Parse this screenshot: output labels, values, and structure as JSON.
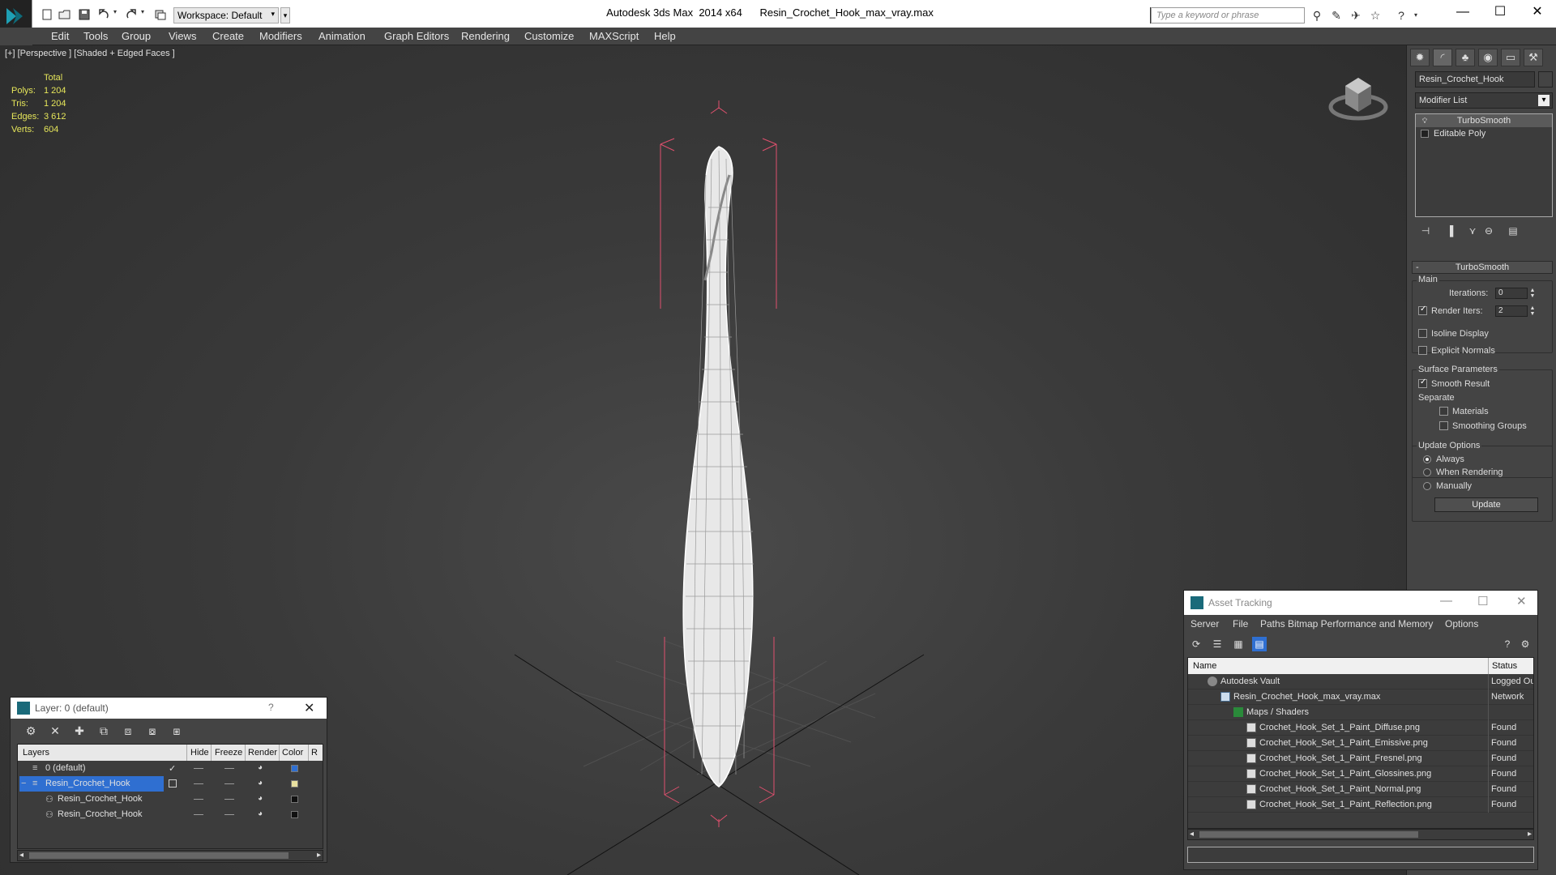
{
  "titlebar": {
    "workspace": "Workspace: Default",
    "title": "Autodesk 3ds Max  2014 x64      Resin_Crochet_Hook_max_vray.max",
    "search_placeholder": "Type a keyword or phrase"
  },
  "menu": [
    "Edit",
    "Tools",
    "Group",
    "Views",
    "Create",
    "Modifiers",
    "Animation",
    "Graph Editors",
    "Rendering",
    "Customize",
    "MAXScript",
    "Help"
  ],
  "viewport": {
    "label": "[+] [Perspective ] [Shaded + Edged Faces ]",
    "stats_header": "Total",
    "stats": [
      {
        "k": "Polys:",
        "v": "1 204"
      },
      {
        "k": "Tris:",
        "v": "1 204"
      },
      {
        "k": "Edges:",
        "v": "3 612"
      },
      {
        "k": "Verts:",
        "v": "604"
      }
    ]
  },
  "command_panel": {
    "object_name": "Resin_Crochet_Hook",
    "modifier_list": "Modifier List",
    "stack": [
      "TurboSmooth",
      "Editable Poly"
    ],
    "rollout_title": "TurboSmooth",
    "main_group": "Main",
    "iterations_label": "Iterations:",
    "iterations_value": "0",
    "render_iters_label": "Render Iters:",
    "render_iters_value": "2",
    "render_iters_checked": true,
    "isoline_label": "Isoline Display",
    "explicit_normals_label": "Explicit Normals",
    "surface_group": "Surface Parameters",
    "smooth_result_label": "Smooth Result",
    "separate_label": "Separate",
    "materials_label": "Materials",
    "smoothing_groups_label": "Smoothing Groups",
    "update_group": "Update Options",
    "always_label": "Always",
    "when_rendering_label": "When Rendering",
    "manually_label": "Manually",
    "update_button": "Update"
  },
  "layer_dialog": {
    "title": "Layer: 0 (default)",
    "help": "?",
    "headers": {
      "layers": "Layers",
      "hide": "Hide",
      "freeze": "Freeze",
      "render": "Render",
      "color": "Color",
      "r": "R"
    },
    "rows": [
      {
        "name": "0 (default)",
        "color": "#2f6fd1"
      },
      {
        "name": "Resin_Crochet_Hook",
        "color": "#e8e0a0"
      },
      {
        "name": "Resin_Crochet_Hook",
        "color": "#111111"
      },
      {
        "name": "Resin_Crochet_Hook",
        "color": "#111111"
      }
    ]
  },
  "asset_dialog": {
    "title": "Asset Tracking",
    "menu": [
      "Server",
      "File",
      "Paths",
      "Bitmap Performance and Memory",
      "Options"
    ],
    "headers": {
      "name": "Name",
      "status": "Status"
    },
    "rows": [
      {
        "name": "Autodesk Vault",
        "status": "Logged Out"
      },
      {
        "name": "Resin_Crochet_Hook_max_vray.max",
        "status": "Network"
      },
      {
        "name": "Maps / Shaders",
        "status": ""
      },
      {
        "name": "Crochet_Hook_Set_1_Paint_Diffuse.png",
        "status": "Found"
      },
      {
        "name": "Crochet_Hook_Set_1_Paint_Emissive.png",
        "status": "Found"
      },
      {
        "name": "Crochet_Hook_Set_1_Paint_Fresnel.png",
        "status": "Found"
      },
      {
        "name": "Crochet_Hook_Set_1_Paint_Glossines.png",
        "status": "Found"
      },
      {
        "name": "Crochet_Hook_Set_1_Paint_Normal.png",
        "status": "Found"
      },
      {
        "name": "Crochet_Hook_Set_1_Paint_Reflection.png",
        "status": "Found"
      }
    ]
  },
  "colors": {
    "selection": "#2f6fd1",
    "stats": "#e6e65a",
    "bbox": "#e0506e"
  }
}
